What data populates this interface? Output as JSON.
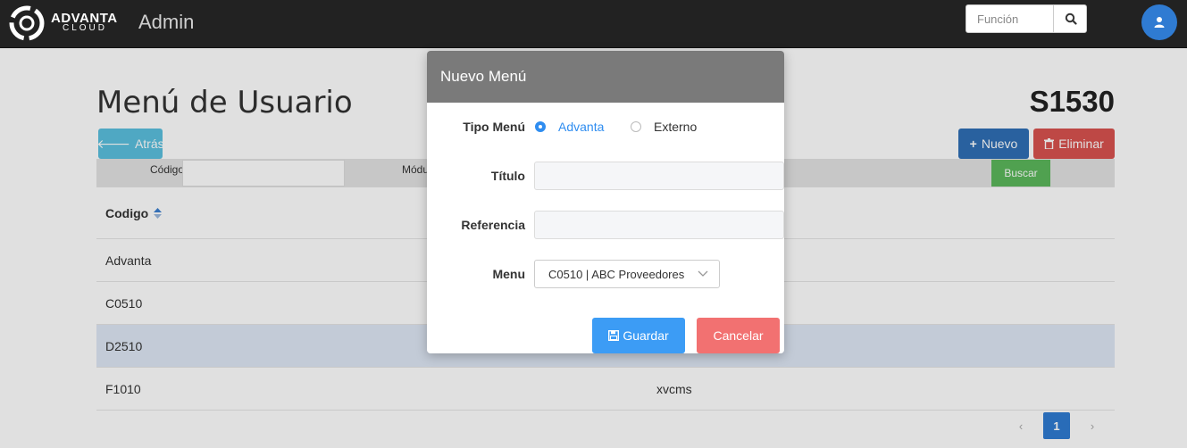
{
  "header": {
    "brand_name": "ADVANTA",
    "brand_sub": "CLOUD",
    "app_title": "Admin",
    "search_placeholder": "Función"
  },
  "page": {
    "title": "Menú de Usuario",
    "code": "S1530",
    "back_label": "Atrás",
    "new_label": "Nuevo",
    "delete_label": "Eliminar",
    "filter": {
      "codigo_label": "Código",
      "modulo_label": "Módu",
      "buscar_label": "Buscar"
    },
    "table": {
      "header_col1": "Codigo",
      "rows": [
        {
          "code": "Advanta",
          "desc": ""
        },
        {
          "code": "C0510",
          "desc": ""
        },
        {
          "code": "D2510",
          "desc": ""
        },
        {
          "code": "F1010",
          "desc": "xvcms"
        }
      ]
    },
    "pagination": {
      "prev": "‹",
      "current": "1",
      "next": "›"
    }
  },
  "modal": {
    "title": "Nuevo Menú",
    "tipo_label": "Tipo Menú",
    "tipo_options": [
      "Advanta",
      "Externo"
    ],
    "tipo_selected": "Advanta",
    "titulo_label": "Título",
    "titulo_value": "",
    "referencia_label": "Referencia",
    "referencia_value": "",
    "menu_label": "Menu",
    "menu_selected": "C0510 | ABC Proveedores",
    "save_label": "Guardar",
    "cancel_label": "Cancelar"
  },
  "colors": {
    "topbar": "#222222",
    "primary": "#3c9cf5",
    "danger": "#f27171",
    "avatar": "#2f7bd2",
    "success": "#5cb85c"
  }
}
